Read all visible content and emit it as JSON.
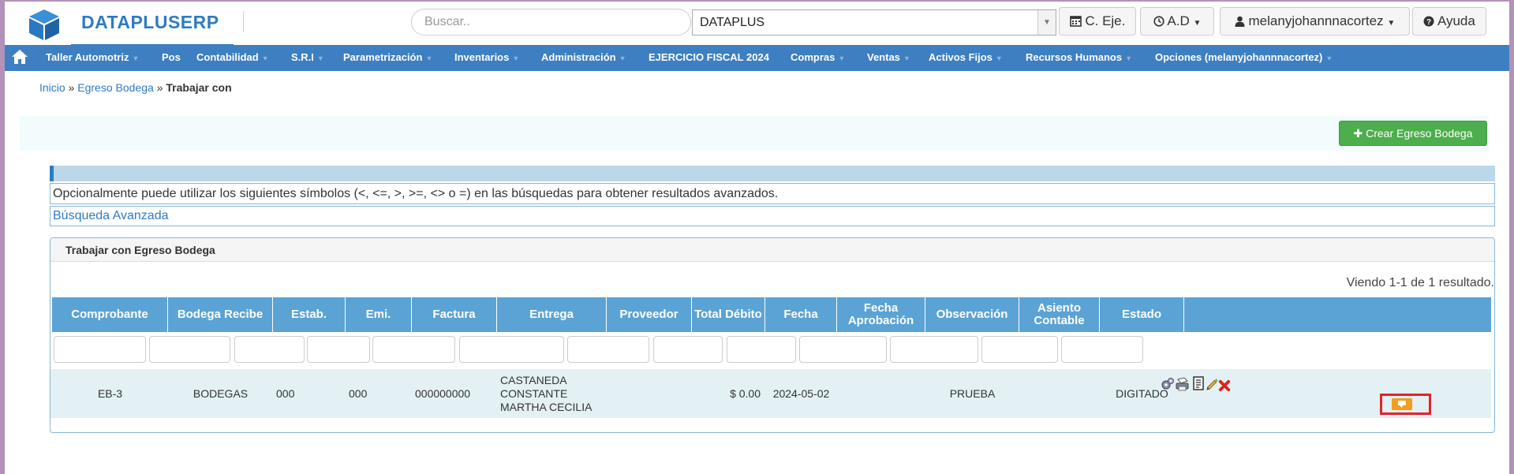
{
  "header": {
    "brand": "DATAPLUSERP",
    "search_placeholder": "Buscar..",
    "company_select": "DATAPLUS",
    "btn_ejercicio": "C. Eje.",
    "btn_ad": "A.D",
    "user": "melanyjohannnacortez",
    "help": "Ayuda"
  },
  "nav": {
    "items": [
      "Taller Automotriz",
      "Pos",
      "Contabilidad",
      "S.R.I",
      "Parametrización",
      "Inventarios",
      "Administración",
      "EJERCICIO FISCAL 2024",
      "Compras",
      "Ventas",
      "Activos Fijos",
      "Recursos Humanos",
      "Opciones (melanyjohannnacortez)"
    ]
  },
  "breadcrumb": {
    "home": "Inicio",
    "sep": "»",
    "parent": "Egreso Bodega",
    "current": "Trabajar con"
  },
  "actions": {
    "create": "Crear Egreso Bodega"
  },
  "search_hint": "Opcionalmente puede utilizar los siguientes símbolos (<, <=, >, >=, <> o =) en las búsquedas para obtener resultados avanzados.",
  "advanced_search": "Búsqueda Avanzada",
  "grid": {
    "title": "Trabajar con Egreso Bodega",
    "summary": "Viendo 1-1 de 1 resultado.",
    "columns": [
      "Comprobante",
      "Bodega Recibe",
      "Estab.",
      "Emi.",
      "Factura",
      "Entrega",
      "Proveedor",
      "Total Débito",
      "Fecha",
      "Fecha Aprobación",
      "Observación",
      "Asiento Contable",
      "Estado"
    ],
    "rows": [
      {
        "comprobante": "EB-3",
        "bodega": "BODEGAS",
        "estab": "000",
        "emi": "000",
        "factura": "000000000",
        "entrega_l1": "CASTANEDA",
        "entrega_l2": "CONSTANTE",
        "entrega_l3": "MARTHA CECILIA",
        "proveedor": "",
        "total": "$ 0.00",
        "fecha": "2024-05-02",
        "fecha_aprobacion": "",
        "observacion": "PRUEBA",
        "asiento": "",
        "estado": "DIGITADO"
      }
    ]
  },
  "colors": {
    "brand": "#2e7bc4",
    "navbar": "#3d7fc1",
    "table_header": "#5ba3d5",
    "create_button": "#4cae4c",
    "highlight": "#e8202a"
  }
}
